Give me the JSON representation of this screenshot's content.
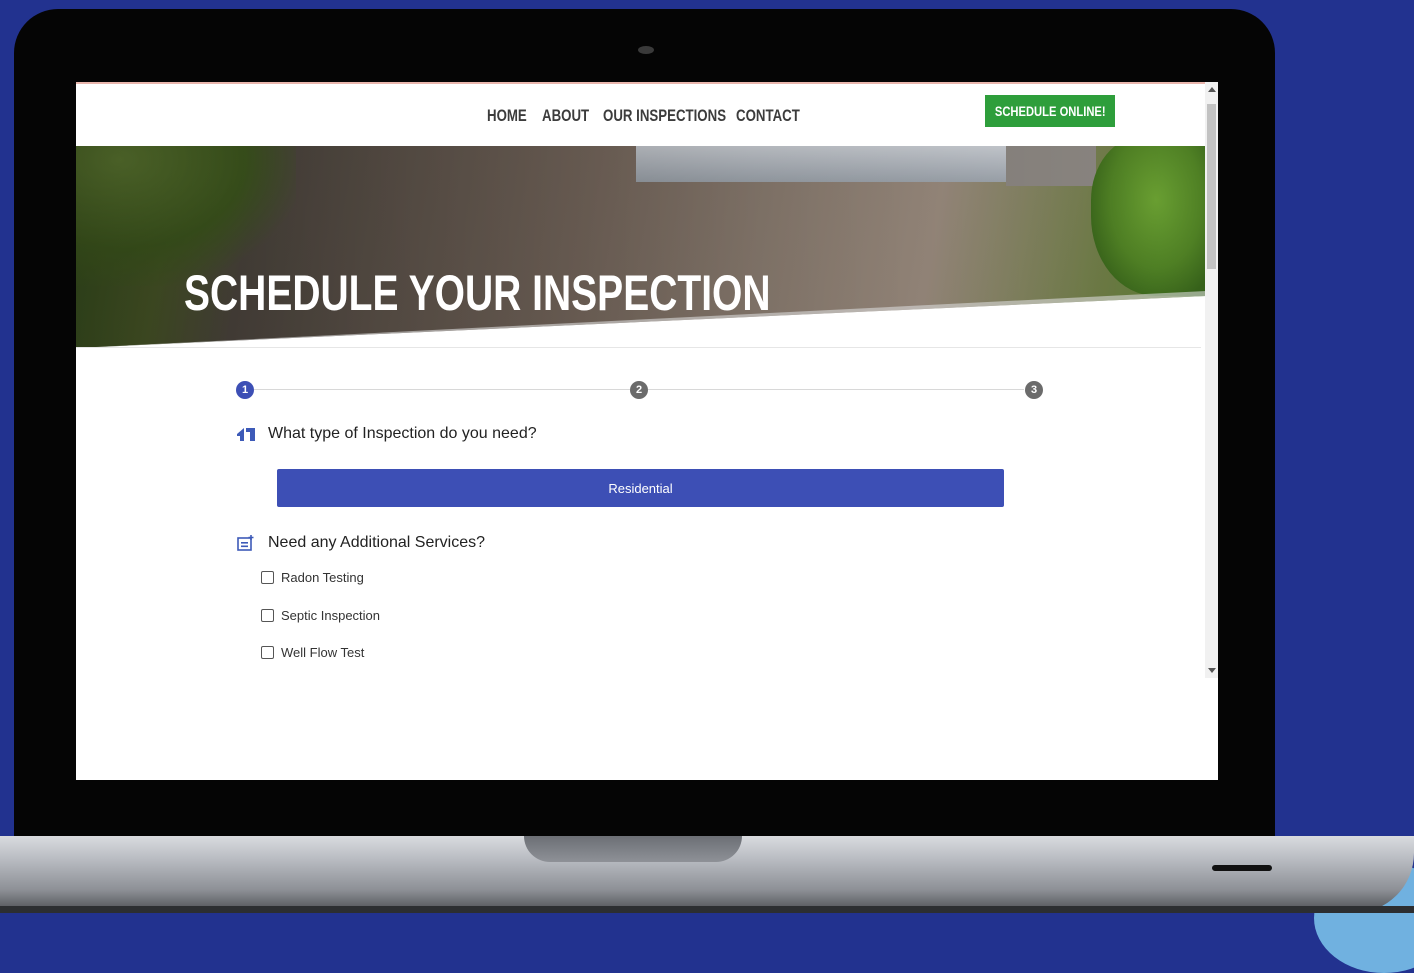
{
  "nav": {
    "links": [
      "HOME",
      "ABOUT",
      "OUR INSPECTIONS",
      "CONTACT"
    ],
    "cta_label": "SCHEDULE ONLINE!"
  },
  "hero": {
    "title": "SCHEDULE YOUR INSPECTION"
  },
  "steps": {
    "items": [
      "1",
      "2",
      "3"
    ],
    "active_index": 0
  },
  "question1": {
    "label": "What type of Inspection do you need?",
    "icon": "home-icon"
  },
  "inspection_option": {
    "label": "Residential"
  },
  "question2": {
    "label": "Need any Additional Services?",
    "icon": "add-list-icon"
  },
  "services": {
    "options": [
      "Radon Testing",
      "Septic Inspection",
      "Well Flow Test"
    ]
  },
  "colors": {
    "background": "#22328f",
    "primary": "#3d4fb5",
    "cta": "#2e9e3b",
    "step_inactive": "#6b6b6b"
  }
}
